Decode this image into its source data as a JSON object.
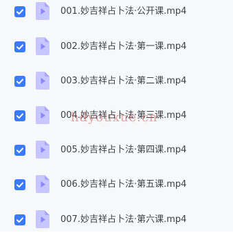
{
  "colors": {
    "background": "#f7f8fa",
    "checkbox": "#3a7bf6",
    "video_icon_light": "#c8c6ff",
    "video_icon_dark": "#8b86ff",
    "text": "#3b3f46"
  },
  "files": [
    {
      "name": "001.妙吉祥占卜法·公开课.mp4",
      "checked": true,
      "icon": "video-file-icon"
    },
    {
      "name": "002.妙吉祥占卜法·第一课.mp4",
      "checked": true,
      "icon": "video-file-icon"
    },
    {
      "name": "003.妙吉祥占卜法·第二课.mp4",
      "checked": true,
      "icon": "video-file-icon"
    },
    {
      "name": "004.妙吉祥占卜法·第三课.mp4",
      "checked": true,
      "icon": "video-file-icon"
    },
    {
      "name": "005.妙吉祥占卜法·第四课.mp4",
      "checked": true,
      "icon": "video-file-icon"
    },
    {
      "name": "006.妙吉祥占卜法·第五课.mp4",
      "checked": true,
      "icon": "video-file-icon"
    },
    {
      "name": "007.妙吉祥占卜法·第六课.mp4",
      "checked": true,
      "icon": "video-file-icon"
    }
  ],
  "watermark": "hdyouxue.cn"
}
